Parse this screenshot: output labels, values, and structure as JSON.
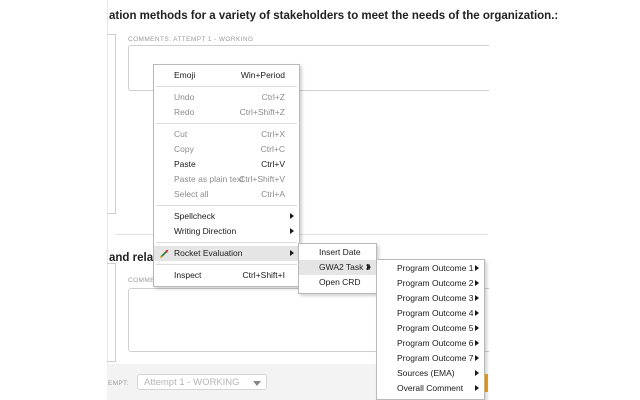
{
  "page": {
    "question_heading": "ation methods for a variety of stakeholders to meet the needs of the organization.:",
    "section_heading": "and relati",
    "comments_label_1": "COMMENTS: ATTEMPT 1 - WORKING",
    "comments_label_2": "COMME",
    "attempt_label": "EMPT:",
    "attempt_value": "Attempt 1 - WORKING"
  },
  "context_menu": {
    "groups": [
      [
        {
          "label": "Emoji",
          "shortcut": "Win+Period",
          "disabled": false
        }
      ],
      [
        {
          "label": "Undo",
          "shortcut": "Ctrl+Z",
          "disabled": true
        },
        {
          "label": "Redo",
          "shortcut": "Ctrl+Shift+Z",
          "disabled": true
        }
      ],
      [
        {
          "label": "Cut",
          "shortcut": "Ctrl+X",
          "disabled": true
        },
        {
          "label": "Copy",
          "shortcut": "Ctrl+C",
          "disabled": true
        },
        {
          "label": "Paste",
          "shortcut": "Ctrl+V",
          "disabled": false
        },
        {
          "label": "Paste as plain text",
          "shortcut": "Ctrl+Shift+V",
          "disabled": true
        },
        {
          "label": "Select all",
          "shortcut": "Ctrl+A",
          "disabled": true
        }
      ],
      [
        {
          "label": "Spellcheck",
          "submenu": true
        },
        {
          "label": "Writing Direction",
          "submenu": true
        }
      ],
      [
        {
          "label": "Rocket Evaluation",
          "submenu": true,
          "icon": "rocket-icon",
          "highlighted": true
        }
      ],
      [
        {
          "label": "Inspect",
          "shortcut": "Ctrl+Shift+I"
        }
      ]
    ]
  },
  "rocket_submenu": {
    "items": [
      {
        "label": "Insert Date"
      },
      {
        "label": "GWA2 Task 3",
        "submenu": true,
        "highlighted": true
      },
      {
        "label": "Open CRD"
      }
    ]
  },
  "gwa_submenu": {
    "items": [
      {
        "label": "Program Outcome 1",
        "submenu": true
      },
      {
        "label": "Program Outcome 2",
        "submenu": true
      },
      {
        "label": "Program Outcome 3",
        "submenu": true
      },
      {
        "label": "Program Outcome 4",
        "submenu": true
      },
      {
        "label": "Program Outcome 5",
        "submenu": true
      },
      {
        "label": "Program Outcome 6",
        "submenu": true
      },
      {
        "label": "Program Outcome 7",
        "submenu": true
      },
      {
        "label": "Sources (EMA)",
        "submenu": true
      },
      {
        "label": "Overall Comment",
        "submenu": true
      }
    ]
  },
  "colors": {
    "menu_highlight": "#e5e5e5",
    "disabled_text": "#8c8c8c",
    "accent_orange": "#f5a623"
  }
}
